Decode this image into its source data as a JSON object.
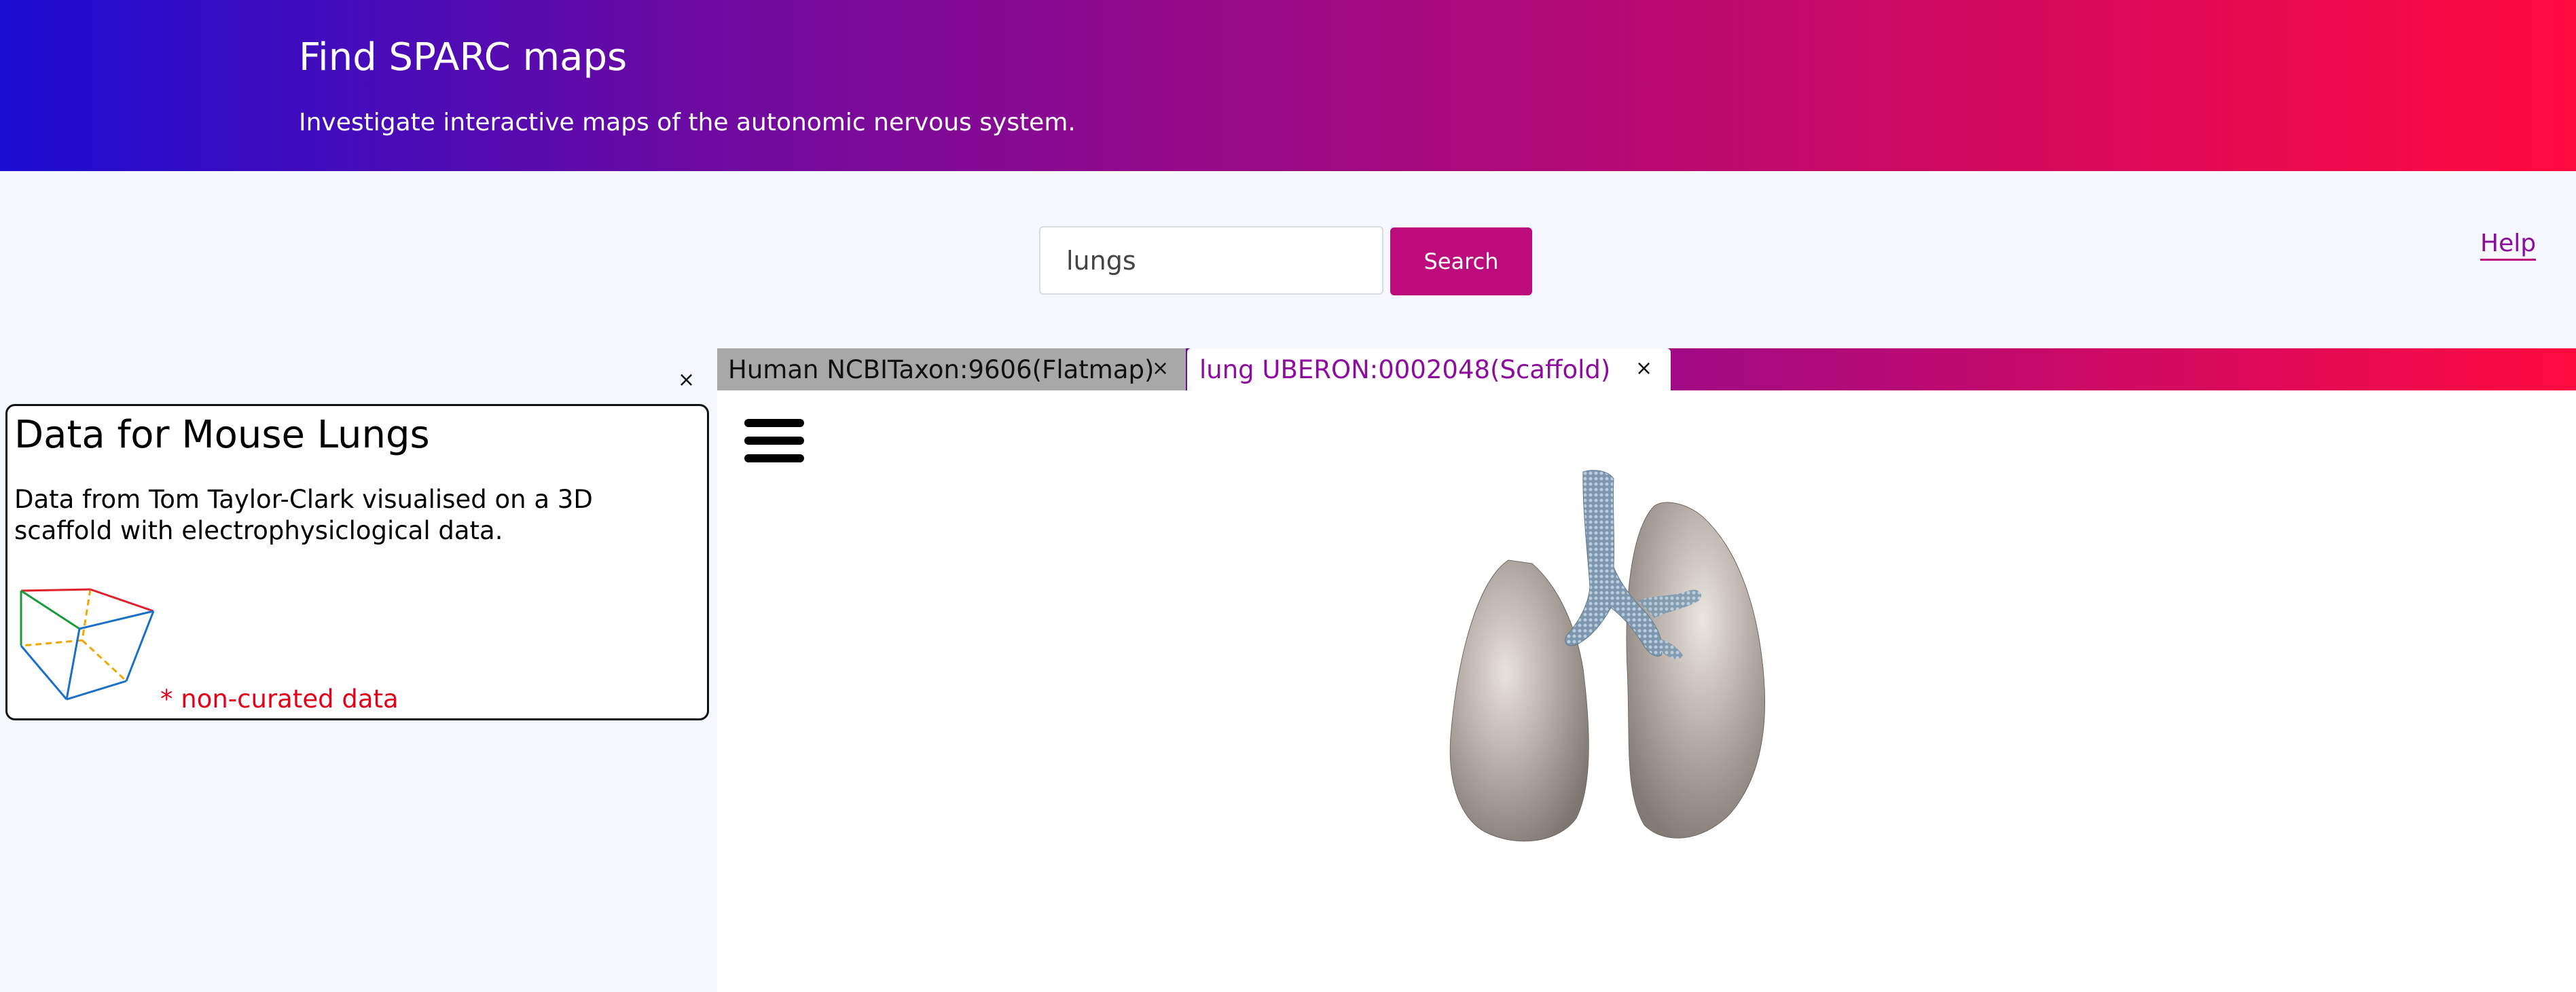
{
  "header": {
    "title": "Find SPARC maps",
    "subtitle": "Investigate interactive maps of the autonomic nervous system."
  },
  "search": {
    "value": "lungs",
    "button_label": "Search"
  },
  "help_label": "Help",
  "panel": {
    "close_glyph": "×",
    "card_title": "Data for Mouse Lungs",
    "card_description": "Data from Tom Taylor-Clark visualised on a 3D scaffold with electrophysiclogical data.",
    "thumbnail_icon": "scaffold-cube-icon",
    "note": "* non-curated data"
  },
  "tabs": [
    {
      "label": "Human NCBITaxon:9606(Flatmap)",
      "close_glyph": "×",
      "active": false
    },
    {
      "label": "lung UBERON:0002048(Scaffold)",
      "close_glyph": "×",
      "active": true
    }
  ],
  "viewer": {
    "menu_icon": "hamburger-menu-icon",
    "model": "3d-lungs-scaffold"
  },
  "colors": {
    "header_gradient_start": "#1b0dd2",
    "header_gradient_end": "#ff0a3f",
    "accent": "#bc0c7b",
    "active_tab_text": "#8c0c9e",
    "inactive_tab_bg": "#a8a8a8",
    "note_text": "#e3001b",
    "page_bg": "#f5f8fe"
  }
}
